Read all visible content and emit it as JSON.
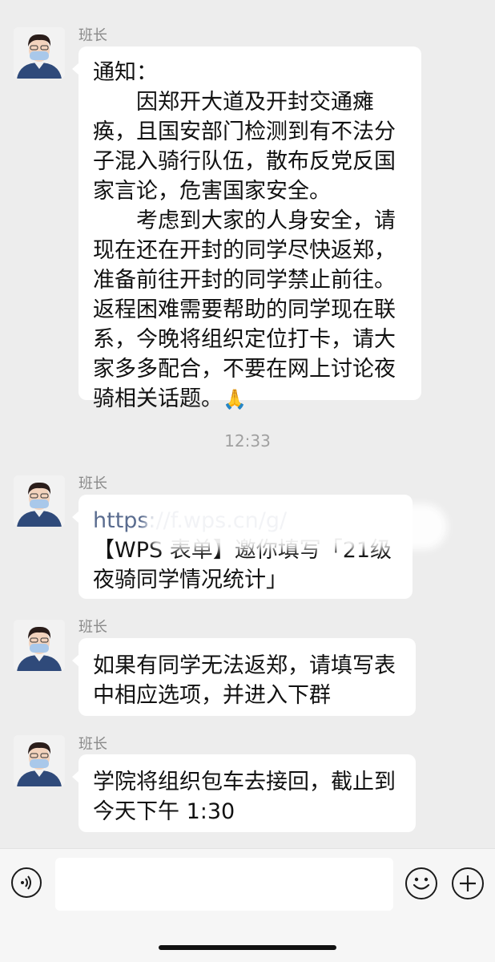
{
  "messages": [
    {
      "sender": "班长",
      "avatar": "masked-man-avatar",
      "paragraphs": [
        "通知：",
        "因郑开大道及开封交通瘫痪，且国安部门检测到有不法分子混入骑行队伍，散布反党反国家言论，危害国家安全。",
        "考虑到大家的人身安全，请现在还在开封的同学尽快返郑，准备前往开封的同学禁止前往。",
        "返程困难需要帮助的同学现在联系，今晚将组织定位打卡，请大家多多配合，不要在网上讨论夜骑相关话题。"
      ],
      "emoji": "folded-hands-emoji"
    },
    {
      "sender": "班长",
      "avatar": "masked-man-avatar",
      "link_visible": "https://f.wps.cn/g/",
      "link_suffix": "/",
      "text": "【WPS 表单】邀你填写「21级夜骑同学情况统计」"
    },
    {
      "sender": "班长",
      "avatar": "masked-man-avatar",
      "text": "如果有同学无法返郑，请填写表中相应选项，并进入下群"
    },
    {
      "sender": "班长",
      "avatar": "masked-man-avatar",
      "text": "学院将组织包车去接回，截止到今天下午 1:30"
    }
  ],
  "timestamp": "12:33",
  "input": {
    "value": "",
    "voice_icon": "voice-icon",
    "emoji_icon": "emoji-icon",
    "plus_icon": "plus-icon"
  },
  "colors": {
    "background": "#ededed",
    "bubble": "#ffffff",
    "link": "#5a6c8f",
    "timestamp": "#a0a0a0"
  }
}
